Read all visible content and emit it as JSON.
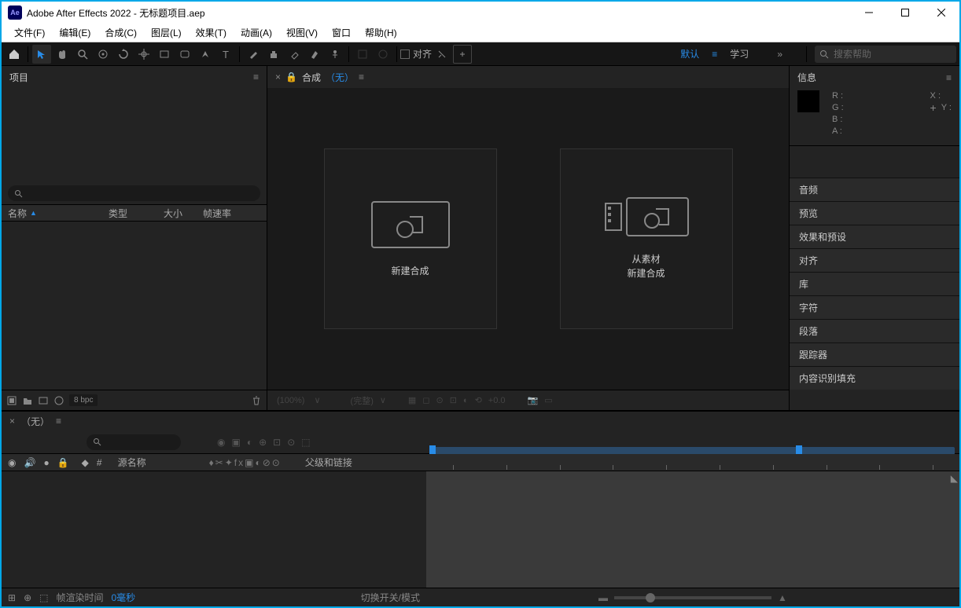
{
  "titlebar": {
    "app": "Adobe After Effects 2022",
    "file": "无标题项目.aep",
    "logo": "Ae"
  },
  "menu": [
    "文件(F)",
    "编辑(E)",
    "合成(C)",
    "图层(L)",
    "效果(T)",
    "动画(A)",
    "视图(V)",
    "窗口",
    "帮助(H)"
  ],
  "toolbar": {
    "align": "对齐",
    "workspace_default": "默认",
    "workspace_learn": "学习",
    "search_placeholder": "搜索帮助"
  },
  "project": {
    "title": "项目",
    "cols": {
      "name": "名称",
      "type": "类型",
      "size": "大小",
      "fps": "帧速率"
    },
    "bpc": "8 bpc"
  },
  "composition": {
    "tab_label": "合成",
    "tab_none": "（无）",
    "new_comp": "新建合成",
    "from_footage_l1": "从素材",
    "from_footage_l2": "新建合成",
    "footer": {
      "pct": "(100%)",
      "full": "(完整)",
      "exposure": "+0.0"
    }
  },
  "info": {
    "title": "信息",
    "r": "R :",
    "g": "G :",
    "b": "B :",
    "a": "A :",
    "x": "X :",
    "y": "Y :"
  },
  "side_panels": [
    "音频",
    "预览",
    "效果和预设",
    "对齐",
    "库",
    "字符",
    "段落",
    "跟踪器",
    "内容识别填充"
  ],
  "timeline": {
    "tab": "（无）",
    "header": {
      "source_name": "源名称",
      "parent": "父级和链接"
    },
    "footer": {
      "render_time": "帧渲染时间",
      "ms": "0毫秒",
      "switches": "切换开关/模式"
    }
  }
}
